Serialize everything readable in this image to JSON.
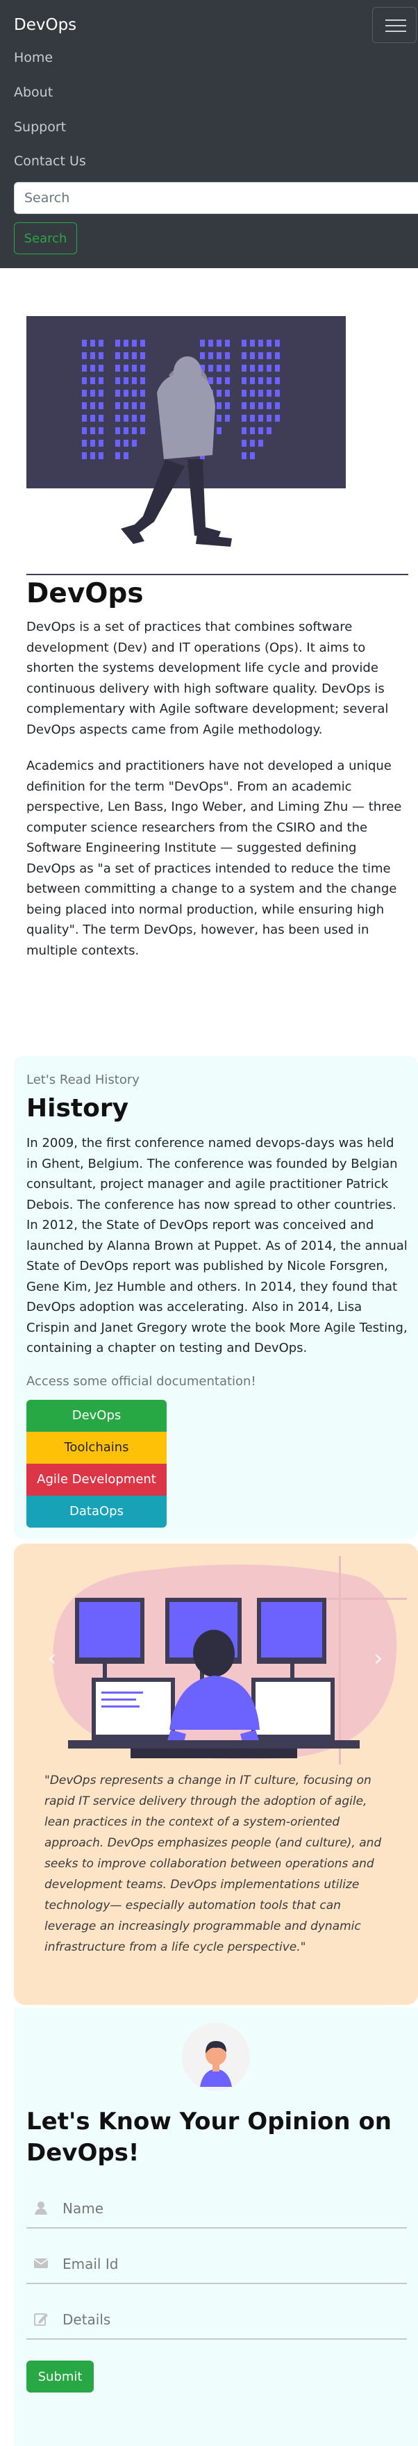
{
  "navbar": {
    "brand": "DevOps",
    "links": [
      "Home",
      "About",
      "Support",
      "Contact Us"
    ],
    "search_placeholder": "Search",
    "search_button": "Search"
  },
  "hero": {
    "title": "DevOps",
    "paragraphs": [
      "DevOps is a set of practices that combines software development (Dev) and IT operations (Ops). It aims to shorten the systems development life cycle and provide continuous delivery with high software quality. DevOps is complementary with Agile software development; several DevOps aspects came from Agile methodology.",
      "Academics and practitioners have not developed a unique definition for the term \"DevOps\". From an academic perspective, Len Bass, Ingo Weber, and Liming Zhu — three computer science researchers from the CSIRO and the Software Engineering Institute — suggested defining DevOps as \"a set of practices intended to reduce the time between committing a change to a system and the change being placed into normal production, while ensuring high quality\". The term DevOps, however, has been used in multiple contexts."
    ]
  },
  "history": {
    "eyebrow": "Let's Read History",
    "title": "History",
    "body": "In 2009, the first conference named devops-days was held in Ghent, Belgium. The conference was founded by Belgian consultant, project manager and agile practitioner Patrick Debois. The conference has now spread to other countries. In 2012, the State of DevOps report was conceived and launched by Alanna Brown at Puppet. As of 2014, the annual State of DevOps report was published by Nicole Forsgren, Gene Kim, Jez Humble and others. In 2014, they found that DevOps adoption was accelerating. Also in 2014, Lisa Crispin and Janet Gregory wrote the book More Agile Testing, containing a chapter on testing and DevOps.",
    "docs_label": "Access some official documentation!",
    "doc_buttons": [
      {
        "label": "DevOps",
        "bg": "#28a745",
        "fg": "#ffffff"
      },
      {
        "label": "Toolchains",
        "bg": "#ffc107",
        "fg": "#212529"
      },
      {
        "label": "Agile Development",
        "bg": "#dc3545",
        "fg": "#ffffff"
      },
      {
        "label": "DataOps",
        "bg": "#17a2b8",
        "fg": "#ffffff"
      }
    ]
  },
  "quote": {
    "text": "\"DevOps represents a change in IT culture, focusing on rapid IT service delivery through the adoption of agile, lean practices in the context of a system-oriented approach. DevOps emphasizes people (and culture), and seeks to improve collaboration between operations and development teams. DevOps implementations utilize technology— especially automation tools that can leverage an increasingly programmable and dynamic infrastructure from a life cycle perspective.\"",
    "prev_icon": "chevron-left-icon",
    "next_icon": "chevron-right-icon"
  },
  "feedback": {
    "title": "Let's Know Your Opinion on DevOps!",
    "fields": [
      {
        "placeholder": "Name",
        "icon": "user-icon"
      },
      {
        "placeholder": "Email Id",
        "icon": "envelope-icon"
      },
      {
        "placeholder": "Details",
        "icon": "edit-icon"
      }
    ],
    "submit": "Submit"
  },
  "colors": {
    "navbar_bg": "#343a40",
    "accent_green": "#28a745",
    "history_bg": "#f0fdfd",
    "quote_card_bg": "#fde4c6"
  }
}
